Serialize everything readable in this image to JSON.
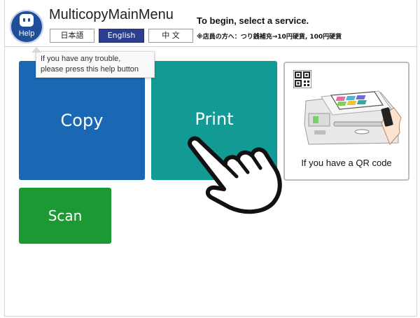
{
  "header": {
    "help_label": "Help",
    "app_title": "MulticopyMainMenu",
    "instruction": "To begin, select a service.",
    "staff_note": "※店員の方へ：つり銭補充→10円硬貨, 100円硬貨",
    "languages": [
      {
        "label": "日本語",
        "active": false
      },
      {
        "label": "English",
        "active": true
      },
      {
        "label": "中 文",
        "active": false
      }
    ]
  },
  "tooltip": {
    "line1": "If you have any trouble,",
    "line2": "please press this help button"
  },
  "services": {
    "copy": "Copy",
    "print": "Print",
    "scan": "Scan",
    "qr": "If you have a QR code"
  },
  "colors": {
    "copy": "#1a68b4",
    "print": "#129a94",
    "scan": "#1b9a33",
    "lang_active": "#2c3f8e",
    "help": "#1f4f9b"
  },
  "icons": [
    "help-robot-icon",
    "qr-code-icon",
    "printer-illustration",
    "pointing-hand-icon"
  ]
}
